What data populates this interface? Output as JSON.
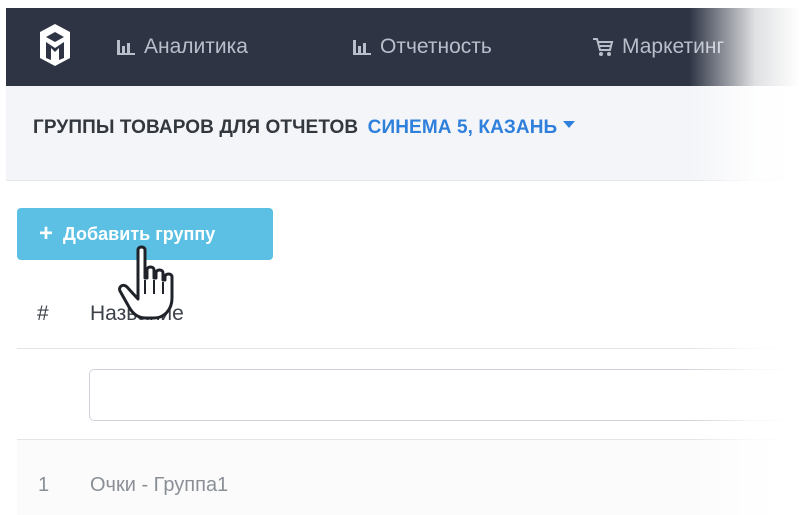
{
  "navbar": {
    "logo_icon": "cube-logo-icon",
    "items": [
      {
        "label": "Аналитика",
        "icon": "bar-chart-icon"
      },
      {
        "label": "Отчетность",
        "icon": "bar-chart-icon"
      },
      {
        "label": "Маркетинг",
        "icon": "cart-icon"
      }
    ]
  },
  "subheader": {
    "title": "ГРУППЫ ТОВАРОВ ДЛЯ ОТЧЕТОВ",
    "cinema": "СИНЕМА 5, КАЗАНЬ"
  },
  "add_button": {
    "label": "Добавить группу",
    "icon": "plus-icon"
  },
  "table": {
    "columns": [
      "#",
      "Название"
    ],
    "filter_value": "",
    "rows": [
      {
        "num": "1",
        "name": "Очки - Группа1"
      }
    ]
  },
  "colors": {
    "navbar_bg": "#2e3444",
    "accent": "#2f80dd",
    "button_bg": "#5bc0e3"
  }
}
